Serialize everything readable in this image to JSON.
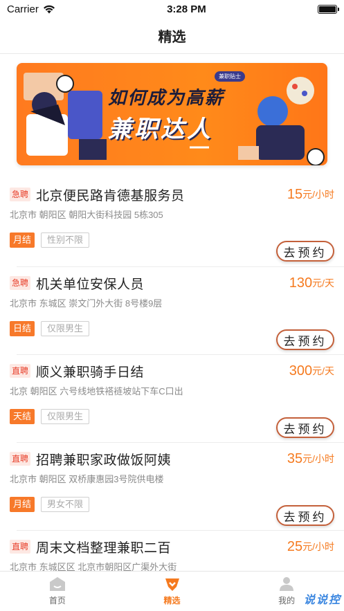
{
  "status_bar": {
    "carrier": "Carrier",
    "time": "3:28 PM"
  },
  "nav": {
    "title": "精选"
  },
  "banner": {
    "tag": "兼职贴士",
    "line1": "如何成为高薪",
    "line2": "兼职达人"
  },
  "jobs": [
    {
      "type": "急聘",
      "title": "北京便民路肯德基服务员",
      "price": "15",
      "unit": "元/小时",
      "address": "北京市 朝阳区 朝阳大街科技园 5栋305",
      "pay": "月结",
      "gender": "性别不限",
      "button": "去预约"
    },
    {
      "type": "急聘",
      "title": "机关单位安保人员",
      "price": "130",
      "unit": "元/天",
      "address": "北京市 东城区 崇文门外大街 8号楼9层",
      "pay": "日结",
      "gender": "仅限男生",
      "button": "去预约"
    },
    {
      "type": "直聘",
      "title": "顺义兼职骑手日结",
      "price": "300",
      "unit": "元/天",
      "address": "北京 朝阳区 六号线地铁褡裢坡站下车C口出",
      "pay": "天结",
      "gender": "仅限男生",
      "button": "去预约"
    },
    {
      "type": "直聘",
      "title": "招聘兼职家政做饭阿姨",
      "price": "35",
      "unit": "元/小时",
      "address": "北京市 朝阳区 双桥康惠园3号院供电楼",
      "pay": "月结",
      "gender": "男女不限",
      "button": "去预约"
    },
    {
      "type": "直聘",
      "title": "周末文档整理兼职二百",
      "price": "25",
      "unit": "元/小时",
      "address": "北京市 东城区区 北京市朝阳区广渠外大街",
      "pay": "",
      "gender": "",
      "button": ""
    }
  ],
  "tabs": [
    {
      "label": "首页",
      "icon": "home-icon"
    },
    {
      "label": "精选",
      "icon": "featured-icon"
    },
    {
      "label": "我的",
      "icon": "profile-icon"
    }
  ],
  "watermark": "说说控",
  "colors": {
    "accent": "#f57a1f",
    "urgent": "#e8412c",
    "banner": "#ff7a1f"
  }
}
